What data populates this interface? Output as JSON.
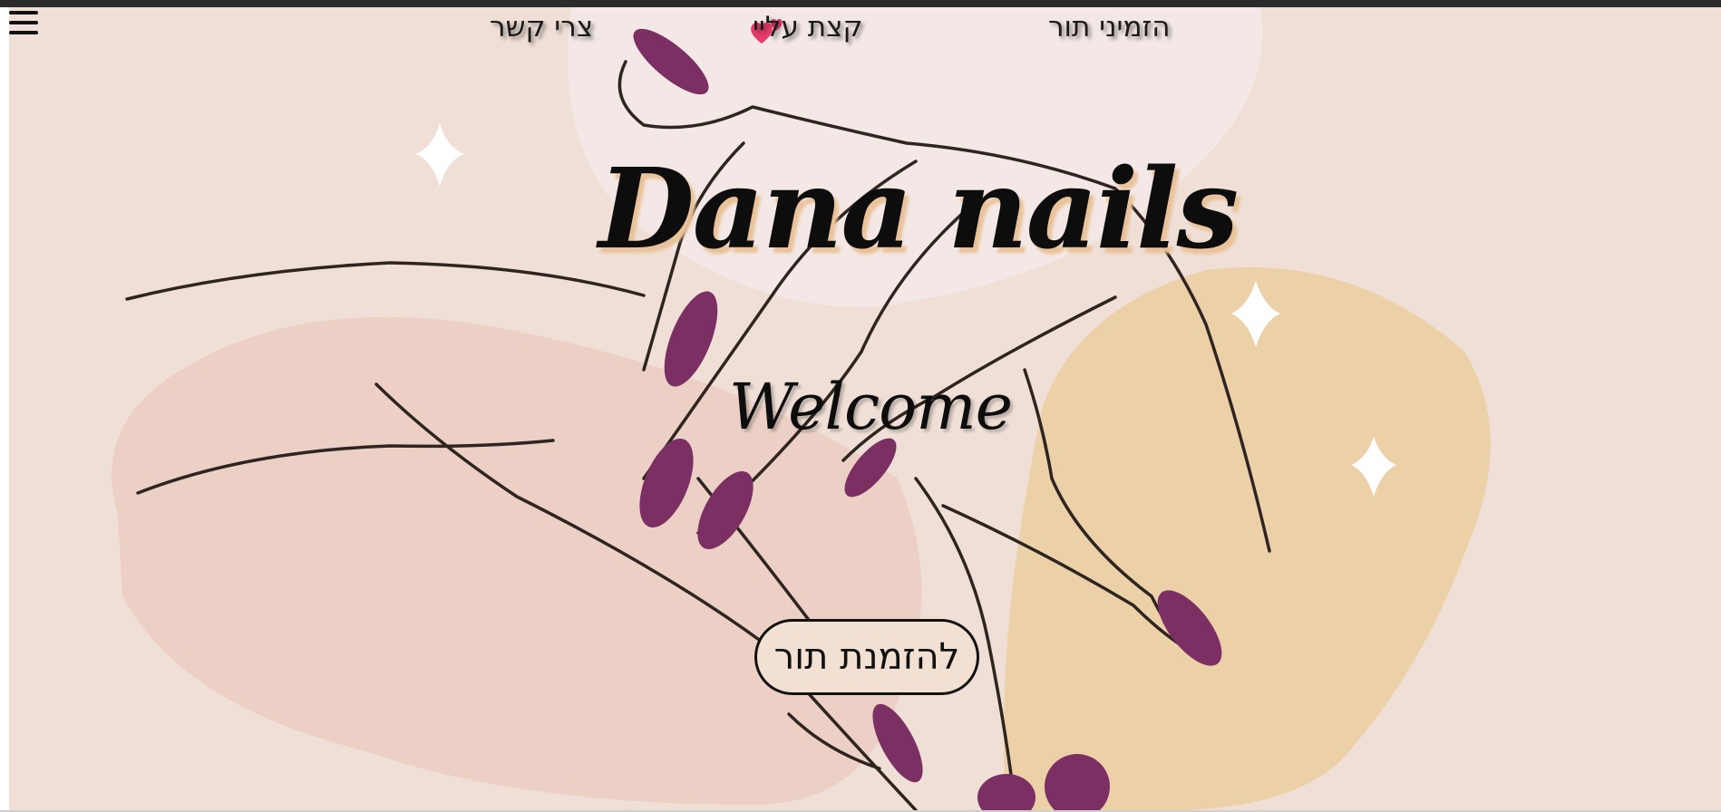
{
  "nav": {
    "contact_label": "צרי קשר",
    "about_label": "קצת עליי",
    "book_label": "הזמיני תור"
  },
  "hero": {
    "title": "Dana nails",
    "subtitle": "Welcome",
    "cta_label": "להזמנת תור"
  },
  "icons": {
    "menu": "hamburger-menu-icon",
    "heart": "two-hearts-icon"
  },
  "colors": {
    "background": "#efdfd6",
    "blob_pink": "#ecd0c5",
    "blob_light": "#f3e8e5",
    "blob_gold": "#ecd0a8",
    "nail_polish": "#7b2f63",
    "title_shadow": "#e9c29a",
    "heart": "#e63d6b"
  }
}
